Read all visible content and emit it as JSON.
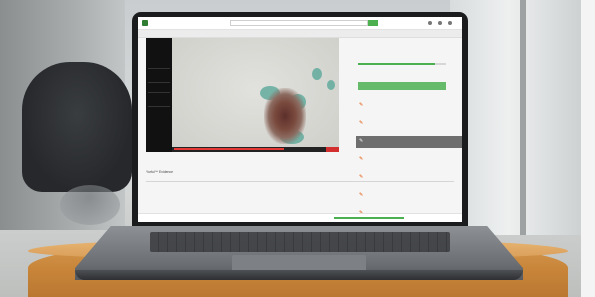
{
  "app": {
    "title": "",
    "search_placeholder": ""
  },
  "breadcrumb": "",
  "video": {
    "stats": [
      "",
      "",
      "",
      "",
      "",
      "",
      "",
      ""
    ],
    "badge": ""
  },
  "caption": "Yurful™ Evidence",
  "course": {
    "title": "",
    "status": "",
    "cta": "",
    "progress": 0.88
  },
  "lessons": [
    {
      "title": "",
      "sub": "",
      "active": false
    },
    {
      "title": "",
      "sub": "",
      "active": false
    },
    {
      "title": "",
      "sub": "",
      "active": true
    },
    {
      "title": "",
      "sub": "",
      "active": false
    },
    {
      "title": "",
      "sub": "",
      "active": false
    },
    {
      "title": "",
      "sub": "",
      "active": false
    },
    {
      "title": "",
      "sub": "",
      "active": false
    }
  ],
  "footer": {
    "text": ""
  },
  "colors": {
    "accent": "#4caf50",
    "lesson_text": "#e53935",
    "active_row": "#6e6e6e"
  }
}
